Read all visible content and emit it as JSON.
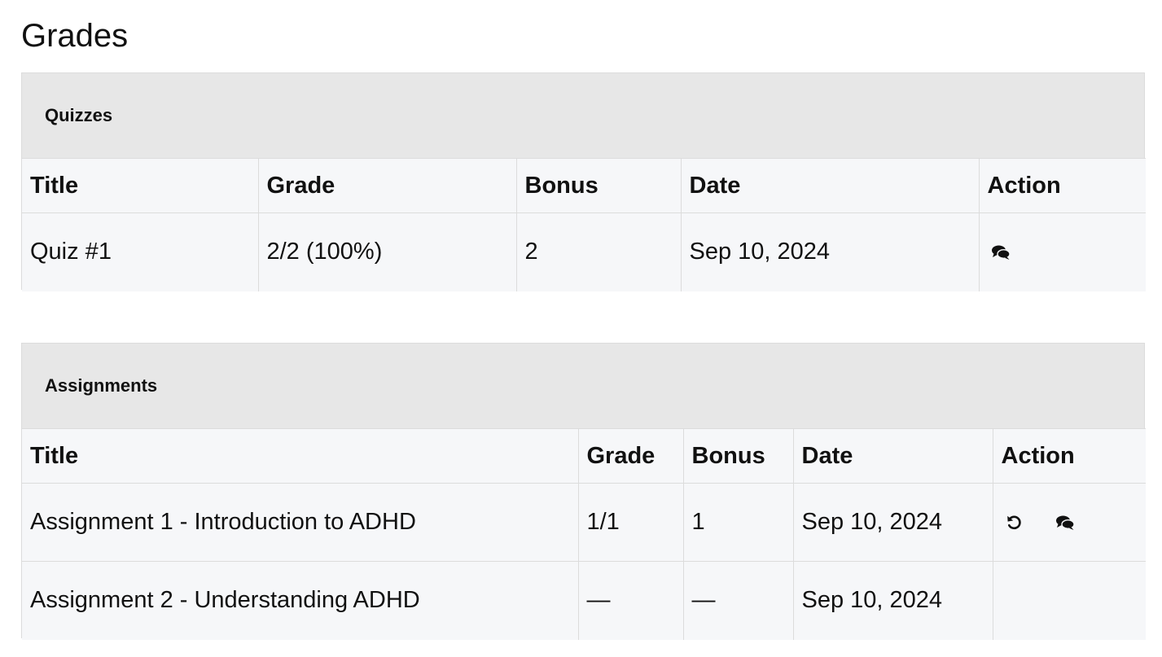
{
  "page": {
    "title": "Grades"
  },
  "quizzes": {
    "heading": "Quizzes",
    "columns": [
      "Title",
      "Grade",
      "Bonus",
      "Date",
      "Action"
    ],
    "rows": [
      {
        "title": "Quiz #1",
        "grade": "2/2 (100%)",
        "bonus": "2",
        "date": "Sep 10, 2024",
        "actions": [
          "comments-icon"
        ]
      }
    ]
  },
  "assignments": {
    "heading": "Assignments",
    "columns": [
      "Title",
      "Grade",
      "Bonus",
      "Date",
      "Action"
    ],
    "rows": [
      {
        "title": "Assignment 1 - Introduction to ADHD",
        "grade": "1/1",
        "bonus": "1",
        "date": "Sep 10, 2024",
        "actions": [
          "undo-icon",
          "comments-icon"
        ]
      },
      {
        "title": "Assignment 2 - Understanding ADHD",
        "grade": "—",
        "bonus": "—",
        "date": "Sep 10, 2024",
        "actions": []
      }
    ]
  },
  "colors": {
    "header_bg": "#e7e7e7",
    "table_bg": "#f6f7f9",
    "border": "#dcdcdc",
    "text": "#111111"
  }
}
